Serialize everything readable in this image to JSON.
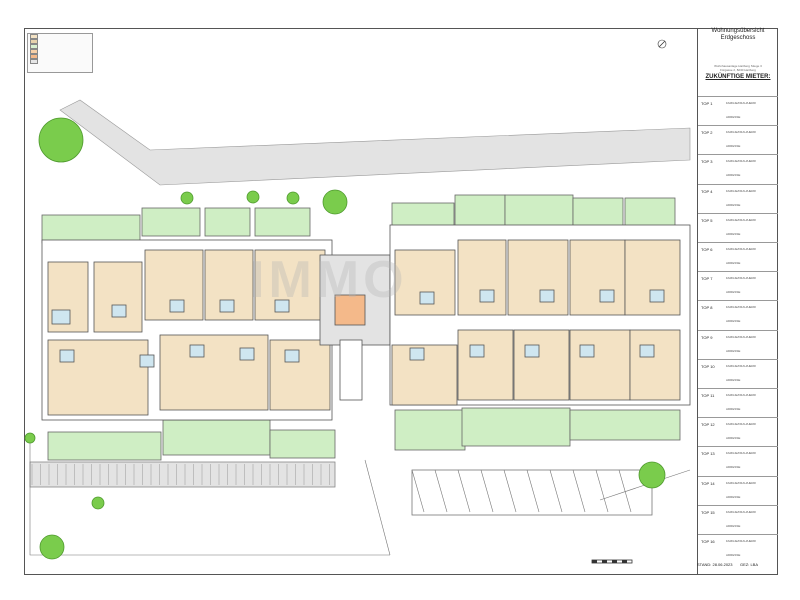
{
  "title_block": {
    "title_line1": "Wohnungsübersicht",
    "title_line2": "Erdgeschoss",
    "project_line1": "Wohnhausanlage Hartberg Stiege 3",
    "project_line2": "Fürgasse 2, 8230 Hartberg",
    "tenants_heading": "ZUKÜNFTIGE MIETER:",
    "name_placeholder": "FAMILIE/FRAU/HERR",
    "address_placeholder": "ADRESSE",
    "tops": [
      "TOP 1",
      "TOP 2",
      "TOP 3",
      "TOP 4",
      "TOP 5",
      "TOP 6",
      "TOP 7",
      "TOP 8",
      "TOP 9",
      "TOP 10",
      "TOP 11",
      "TOP 12",
      "TOP 13",
      "TOP 14",
      "TOP 15",
      "TOP 16"
    ],
    "stand": "STAND: 28.06.2023",
    "gez": "GEZ: LBA"
  },
  "watermark": "IMMO",
  "legend": {
    "swatches": [
      {
        "color": "#f3e2c4"
      },
      {
        "color": "#e7d2ad"
      },
      {
        "color": "#d9f0d0"
      },
      {
        "color": "#f7d0a8"
      },
      {
        "color": "#f4b98a"
      },
      {
        "color": "#e6e6e6"
      }
    ]
  },
  "colors": {
    "apartment": "#f3e2c4",
    "garden": "#cfeec4",
    "bathroom": "#cfe6f0",
    "corridor": "#ffffff",
    "wall": "#555555",
    "stair": "#f4b98a",
    "tree": "#7acc4c",
    "parking": "#ffffff",
    "shade": "#e3e3e3"
  }
}
